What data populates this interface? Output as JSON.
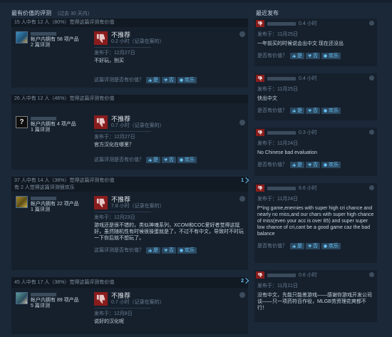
{
  "left_title": "最有价值的评测",
  "left_title_sub": "（过去 30 天内）",
  "right_title": "最近发布",
  "not_recommended": "不推荐",
  "helpful_q": "这篇评测是否有价值？",
  "btn_yes": "是",
  "btn_no": "否",
  "btn_funny": "欢乐",
  "reviews": [
    {
      "head": "15 人中有 12 人（80%）觉得这篇评测有价值",
      "head2": "",
      "avatar": "avatar",
      "avatar_text": "",
      "products": "帐户内拥有 58 项产品",
      "reviews_count": "2 篇评测",
      "hours": "0.2 小时（记录在案的）",
      "posted": "发布于：12月27日",
      "content": "不好玩，别买",
      "count_badge": ""
    },
    {
      "head": "26 人中有 12 人（46%）觉得这篇评测有价值",
      "head2": "",
      "avatar": "avatar",
      "avatar_text": "?",
      "products": "帐户内拥有 4 项产品",
      "reviews_count": "1 篇评测",
      "hours": "0.7 小时（记录在案的）",
      "posted": "发布于：12月27日",
      "content": "官方汉化在哪里？",
      "count_badge": ""
    },
    {
      "head": "37 人中有 14 人（38%）觉得这篇评测有价值",
      "head2": "有 2 人觉得这篇评测很欢乐",
      "avatar": "avatar",
      "avatar_text": "",
      "products": "帐户内拥有 22 项产品",
      "reviews_count": "1 篇评测",
      "hours": "7.8 小时（记录在案的）",
      "posted": "发布于：12月23日",
      "content": "游戏还是很不错的，类似神魂系列，XCOM和COC爱好者觉得这挺好，虽然随机性有时候很操蛋就是了，不过不有中文，导致时不时玩一下你后就不想玩了。",
      "count_badge": "1"
    },
    {
      "head": "45 人中有 17 人（38%）觉得这篇评测有价值",
      "head2": "",
      "avatar": "avatar",
      "avatar_text": "",
      "products": "帐户内拥有 89 项产品",
      "reviews_count": "5 篇评测",
      "hours": "0.7 小时（记录在案的）",
      "posted": "发布于：12月8日",
      "content": "说好的汉化呢",
      "count_badge": "2"
    }
  ],
  "recent": [
    {
      "hours": "0.4 小时",
      "posted": "发布于：11月25日",
      "content": "一年前买的时候说会出中文 现在还没出"
    },
    {
      "hours": "0.4 小时",
      "posted": "发布于：11月25日",
      "content": "快出中文"
    },
    {
      "hours": "0.3 小时",
      "posted": "发布于：11月24日",
      "content": "No Chinese bad evaluation"
    },
    {
      "hours": "6.6 小时",
      "posted": "发布于：11月24日",
      "content": "f**ing game,enemies with super high cri chance and nearly no miss,and our chars with super high chance of miss(even your acc is over 85) and super super low chance of cri,cant be a good game caz the bad balance"
    },
    {
      "hours": "0.6 小时",
      "posted": "发布于：11月21日",
      "content": "没有中文，先能只能差游戏——感谢你游戏开发公司谈——只一项药符百作役，MLGB劳资理花爽都不行！"
    }
  ],
  "right_helpful_q": "是否有价值？",
  "colors": {
    "background": "#1b2838",
    "card": "#16202d",
    "thumb_down": "#8a1c1c",
    "link": "#67c1f5"
  }
}
